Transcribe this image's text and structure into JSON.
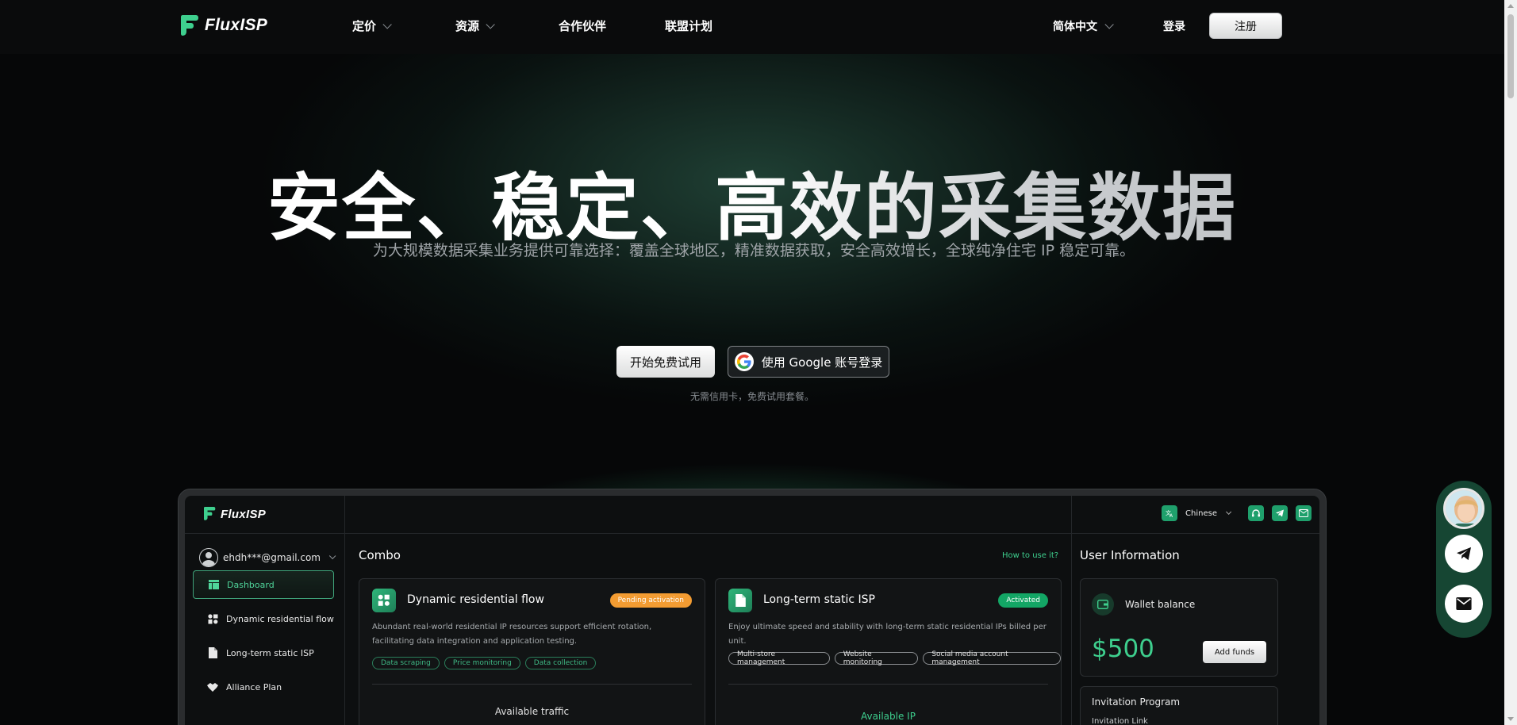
{
  "nav": {
    "brand": "FluxISP",
    "links": [
      {
        "label": "定价",
        "has_dropdown": true
      },
      {
        "label": "资源",
        "has_dropdown": true
      },
      {
        "label": "合作伙伴",
        "has_dropdown": false
      },
      {
        "label": "联盟计划",
        "has_dropdown": false
      }
    ],
    "language": "简体中文",
    "login": "登录",
    "signup": "注册"
  },
  "hero": {
    "title": "安全、稳定、高效的采集数据",
    "subtitle": "为大规模数据采集业务提供可靠选择：覆盖全球地区，精准数据获取，安全高效增长，全球纯净住宅 IP 稳定可靠。",
    "cta_trial": "开始免费试用",
    "cta_google": "使用 Google 账号登录",
    "note": "无需信用卡，免费试用套餐。"
  },
  "dashboard": {
    "brand": "FluxISP",
    "user_email": "ehdh***@gmail.com",
    "language": "Chinese",
    "sidebar": [
      {
        "label": "Dashboard",
        "icon": "dashboard-icon",
        "active": true
      },
      {
        "label": "Dynamic residential flow",
        "icon": "dynamic-flow-icon",
        "active": false
      },
      {
        "label": "Long-term static ISP",
        "icon": "document-icon",
        "active": false
      },
      {
        "label": "Alliance Plan",
        "icon": "handshake-icon",
        "active": false
      }
    ],
    "combo_title": "Combo",
    "how_to_use": "How to use it?",
    "cards": [
      {
        "title": "Dynamic residential flow",
        "status": "Pending activation",
        "description": "Abundant real-world residential IP resources support efficient rotation, facilitating data integration and application testing.",
        "tags": [
          "Data scraping",
          "Price monitoring",
          "Data collection"
        ],
        "footer_label": "Available traffic"
      },
      {
        "title": "Long-term static ISP",
        "status": "Activated",
        "description": "Enjoy ultimate speed and stability with long-term static residential IPs billed per unit.",
        "tags": [
          "Multi-store management",
          "Website monitoring",
          "Social media account management"
        ],
        "footer_label": "Available IP"
      }
    ],
    "user_info": {
      "title": "User Information",
      "wallet_label": "Wallet balance",
      "wallet_amount": "$500",
      "add_funds": "Add funds",
      "invitation_title": "Invitation Program",
      "invitation_link_label": "Invitation Link"
    }
  },
  "colors": {
    "accent": "#3ecf8e",
    "pending": "#f39c32",
    "activated": "#13a665",
    "background": "#060708"
  }
}
